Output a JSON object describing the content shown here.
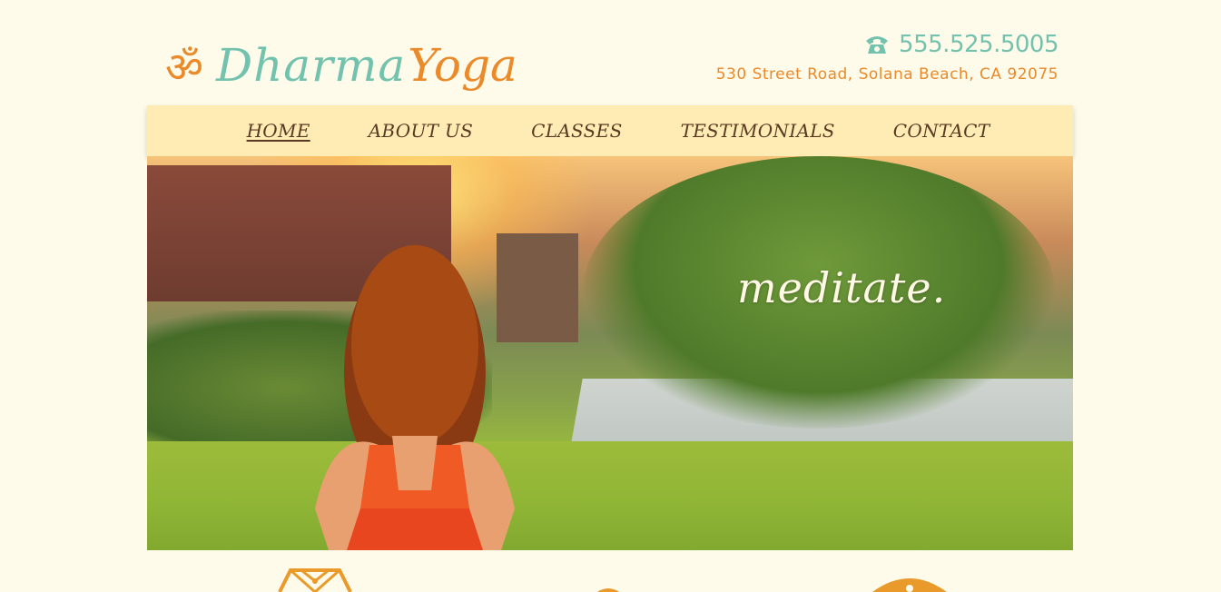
{
  "brand": {
    "name_part1": "Dharma",
    "name_part2": "Yoga",
    "symbol": "ॐ",
    "colors": {
      "teal": "#72c2ae",
      "orange": "#ea8a2a",
      "cream": "#fffbea",
      "nav_bg": "#ffecb5",
      "nav_text": "#5a3a22"
    }
  },
  "contact": {
    "phone_icon": "telephone-icon",
    "phone": "555.525.5005",
    "address": "530 Street Road, Solana Beach, CA 92075"
  },
  "nav": {
    "items": [
      {
        "label": "HOME",
        "active": true
      },
      {
        "label": "ABOUT US",
        "active": false
      },
      {
        "label": "CLASSES",
        "active": false
      },
      {
        "label": "TESTIMONIALS",
        "active": false
      },
      {
        "label": "CONTACT",
        "active": false
      }
    ]
  },
  "hero": {
    "overlay_text": "meditate."
  },
  "features": {
    "icons": [
      "geometric-lotus-icon",
      "circle-icon",
      "mandala-icon"
    ]
  }
}
